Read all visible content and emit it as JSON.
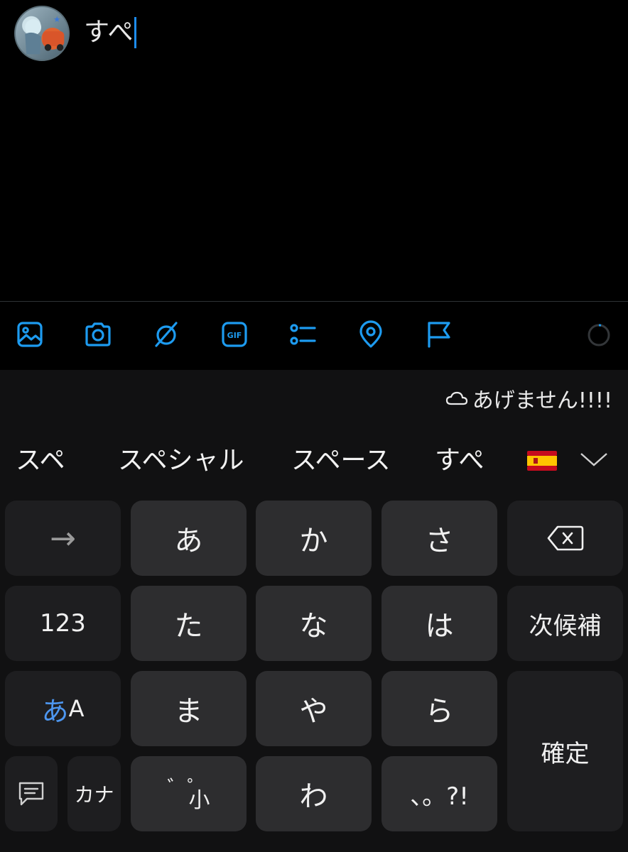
{
  "compose": {
    "text": "すぺ"
  },
  "toolbar": {
    "icons": [
      "image-icon",
      "camera-icon",
      "grok-icon",
      "gif-icon",
      "poll-icon",
      "location-icon",
      "flag-icon"
    ],
    "accent": "#1d9bf0"
  },
  "keyboard": {
    "cloud_suggestion": "あげません!!!!",
    "candidates": [
      "スペ",
      "スペシャル",
      "スペース",
      "すぺ"
    ],
    "keys": {
      "arrow": "→",
      "a": "あ",
      "ka": "か",
      "sa": "さ",
      "num": "123",
      "ta": "た",
      "na": "な",
      "ha": "は",
      "next_candidate": "次候補",
      "mode_kana": "あ",
      "mode_alpha": "A",
      "ma": "ま",
      "ya": "や",
      "ra": "ら",
      "confirm": "確定",
      "kana": "カナ",
      "dakuten": "゛゜",
      "small": "小",
      "wa": "わ",
      "punct": "、。?!"
    }
  }
}
